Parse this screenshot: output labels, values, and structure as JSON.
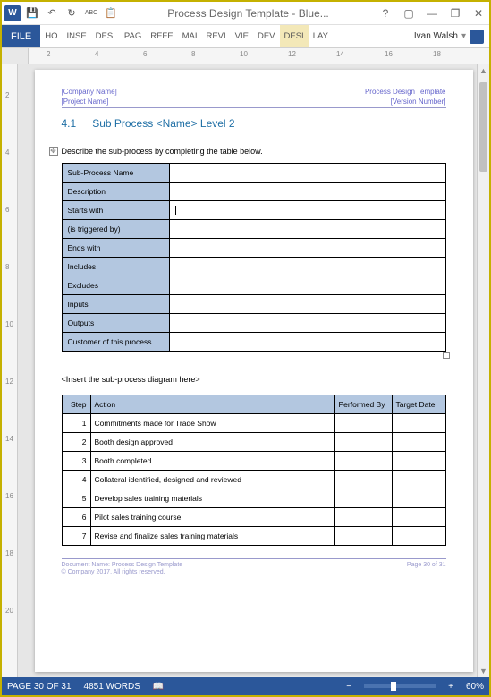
{
  "titlebar": {
    "app_icon": "W",
    "title": "Process Design Template - Blue...",
    "help": "?",
    "ribbon_toggle": "▢",
    "minimize": "—",
    "restore": "❐",
    "close": "✕"
  },
  "qat": {
    "save": "💾",
    "undo": "↶",
    "redo": "↻",
    "spell": "ABC",
    "paste": "📋"
  },
  "ribbon": {
    "file": "FILE",
    "tabs": [
      "HO",
      "INSE",
      "DESI",
      "PAG",
      "REFE",
      "MAI",
      "REVI",
      "VIE",
      "DEV",
      "DESI",
      "LAY"
    ],
    "user": "Ivan Walsh"
  },
  "ruler_h": [
    "2",
    "4",
    "6",
    "8",
    "10",
    "12",
    "14",
    "16",
    "18"
  ],
  "ruler_v": [
    "2",
    "4",
    "6",
    "8",
    "10",
    "12",
    "14",
    "16",
    "18",
    "20"
  ],
  "doc": {
    "header": {
      "company": "[Company Name]",
      "project": "[Project Name]",
      "template": "Process Design Template",
      "version": "[Version Number]"
    },
    "section": {
      "num": "4.1",
      "title": "Sub Process <Name> Level 2"
    },
    "desc": "Describe the sub-process by completing the table below.",
    "proc_rows": [
      "Sub-Process Name",
      "Description",
      "Starts with",
      "(is triggered by)",
      "Ends with",
      "Includes",
      "Excludes",
      "Inputs",
      "Outputs",
      "Customer of this process"
    ],
    "insert_text": "<Insert the sub-process diagram here>",
    "steps_header": {
      "step": "Step",
      "action": "Action",
      "perf": "Performed By",
      "date": "Target Date"
    },
    "steps": [
      {
        "n": "1",
        "action": "Commitments made for Trade Show"
      },
      {
        "n": "2",
        "action": "Booth design approved"
      },
      {
        "n": "3",
        "action": "Booth completed"
      },
      {
        "n": "4",
        "action": "Collateral identified, designed and reviewed"
      },
      {
        "n": "5",
        "action": "Develop sales training materials"
      },
      {
        "n": "6",
        "action": "Pilot sales training course"
      },
      {
        "n": "7",
        "action": "Revise and finalize sales training materials"
      }
    ],
    "footer": {
      "docname": "Document Name: Process Design Template",
      "copyright": "© Company 2017. All rights reserved.",
      "page": "Page 30 of 31"
    }
  },
  "status": {
    "page": "PAGE 30 OF 31",
    "words": "4851 WORDS",
    "proof": "📖",
    "zoom_minus": "−",
    "zoom_plus": "+",
    "zoom": "60%"
  }
}
